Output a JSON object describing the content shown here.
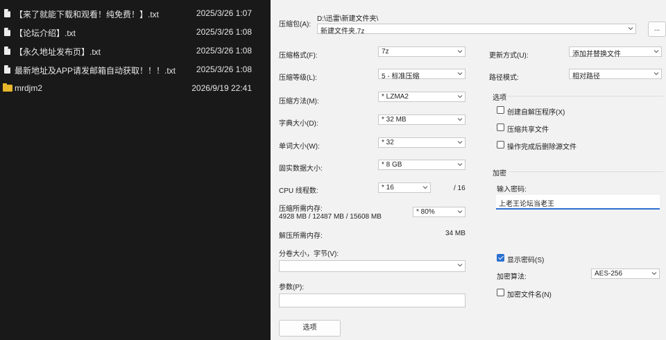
{
  "file_list": [
    {
      "name": "【来了就能下载和观看！纯免费！】.txt",
      "date": "2025/3/26 1:07",
      "kind": "file"
    },
    {
      "name": "【论坛介绍】.txt",
      "date": "2025/3/26 1:08",
      "kind": "file"
    },
    {
      "name": "【永久地址发布页】.txt",
      "date": "2025/3/26 1:08",
      "kind": "file"
    },
    {
      "name": "最新地址及APP请发邮箱自动获取！！！.txt",
      "date": "2025/3/26 1:08",
      "kind": "file"
    },
    {
      "name": "mrdjm2",
      "date": "2026/9/19 22:41",
      "kind": "folder"
    }
  ],
  "dialog": {
    "archive_name_label": "压缩包(A):",
    "archive_path": "D:\\迅雷\\新建文件夹\\",
    "archive_name_value": "新建文件夹.7z",
    "browse_label": "...",
    "format_label": "压缩格式(F):",
    "format_value": "7z",
    "level_label": "压缩等级(L):",
    "level_value": "5 - 标准压缩",
    "method_label": "压缩方法(M):",
    "method_value": "* LZMA2",
    "dict_label": "字典大小(D):",
    "dict_value": "* 32 MB",
    "word_label": "单词大小(W):",
    "word_value": "* 32",
    "solid_label": "固实数据大小:",
    "solid_value": "* 8 GB",
    "cpu_label": "CPU 线程数:",
    "cpu_value": "* 16",
    "cpu_total": "/ 16",
    "mem_label": "压缩所需内存:",
    "mem_detail": "4928 MB / 12487 MB / 15608 MB",
    "mem_value": "* 80%",
    "decomp_label": "解压所需内存:",
    "decomp_value": "34 MB",
    "split_label": "分卷大小，字节(V):",
    "split_value": "",
    "params_label": "参数(P):",
    "params_value": "",
    "options_button": "选项",
    "update_label": "更新方式(U):",
    "update_value": "添加并替换文件",
    "path_label": "路径模式:",
    "path_value": "相对路径",
    "options_group": "选项",
    "opt_sfx": "创建自解压程序(X)",
    "opt_shared": "压缩共享文件",
    "opt_delete": "操作完成后删除源文件",
    "encrypt_group": "加密",
    "password_label": "输入密码:",
    "password_value": "上老王论坛当老王",
    "show_pwd": "显示密码(S)",
    "enc_method_label": "加密算法:",
    "enc_method_value": "AES-256",
    "encrypt_names": "加密文件名(N)"
  }
}
